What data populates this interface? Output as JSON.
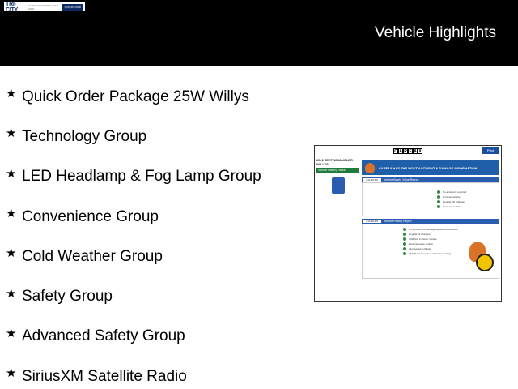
{
  "header": {
    "logo_text": "TRI-CITY",
    "logo_subtext": "CHRYSLER DODGE JEEP RAM",
    "logo_box_text": "(920) 952-6000",
    "title": "Vehicle Highlights"
  },
  "features": [
    "Quick Order Package 25W Willys",
    "Technology Group",
    "LED Headlamp & Fog Lamp Group",
    "Convenience Group",
    "Cold Weather Group",
    "Safety Group",
    "Advanced Safety Group",
    "SiriusXM Satellite Radio"
  ],
  "carfax": {
    "logo_letters": [
      "C",
      "A",
      "R",
      "F",
      "A",
      "X"
    ],
    "login": "Print",
    "vehicle_title": "2022 JEEP WRANGLER WILLYS",
    "nav_item": "Vehicle History Report",
    "banner": "CARFAX HAS THE MOST ACCIDENT & DAMAGE INFORMATION",
    "section1": "Vehicle Based Value Report",
    "section2": "Vehicle History Report",
    "rows1": [
      "No accidents reported",
      "1 Owner vehicle",
      "Regular Oil Changes",
      "Personal vehicle"
    ],
    "rows2": [
      "No accidents or damage reported to CARFAX",
      "Regular oil changes",
      "CARFAX 1-Owner vehicle",
      "Personal lease vehicle",
      "Last owned in Illinois",
      "38,886 Last reported odometer reading"
    ]
  }
}
